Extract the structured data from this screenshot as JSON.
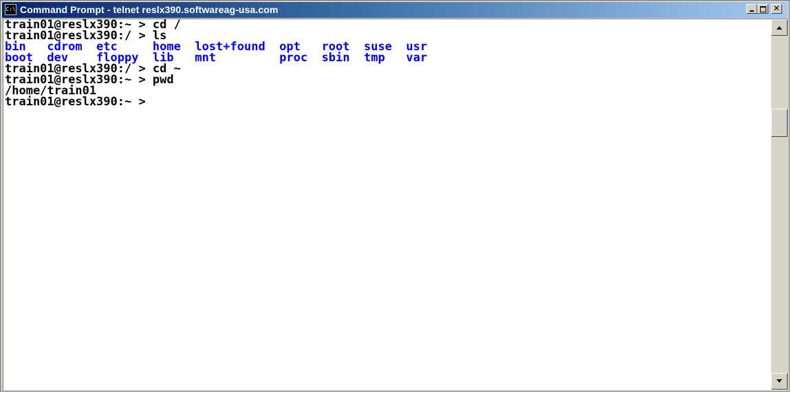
{
  "window": {
    "title": "Command Prompt - telnet reslx390.softwareag-usa.com",
    "icon": "cmd-icon",
    "controls": [
      "minimize",
      "maximize",
      "close"
    ]
  },
  "terminal": {
    "lines": [
      {
        "type": "prompt",
        "text": "train01@reslx390:~ > cd /"
      },
      {
        "type": "prompt",
        "text": "train01@reslx390:/ > ls"
      },
      {
        "type": "listing",
        "text": "bin   cdrom  etc     home  lost+found  opt   root  suse  usr"
      },
      {
        "type": "listing",
        "text": "boot  dev    floppy  lib   mnt         proc  sbin  tmp   var"
      },
      {
        "type": "prompt",
        "text": "train01@reslx390:/ > cd ~"
      },
      {
        "type": "prompt",
        "text": "train01@reslx390:~ > pwd"
      },
      {
        "type": "output",
        "text": "/home/train01"
      },
      {
        "type": "prompt",
        "text": "train01@reslx390:~ >"
      }
    ],
    "colors": {
      "text": "#000000",
      "directory": "#0000ff",
      "background": "#ffffff"
    }
  },
  "scrollbar": {
    "position_fraction": 0.24
  }
}
